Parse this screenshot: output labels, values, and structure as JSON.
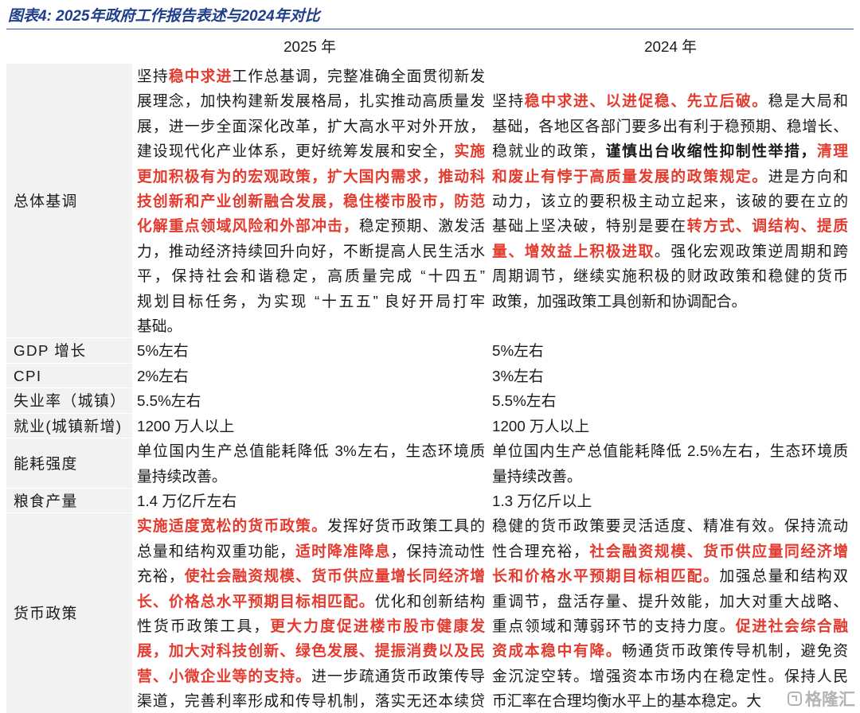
{
  "title": "图表4: 2025年政府工作报告表述与2024年对比",
  "header": {
    "col2025": "2025 年",
    "col2024": "2024 年"
  },
  "colors": {
    "title": "#1f3e8a",
    "rule": "#2f55a4",
    "emphasis": "#e53a2e",
    "label_bg": "#f2f2f2"
  },
  "rows": [
    {
      "label": "总体基调",
      "y2025": [
        [
          {
            "t": "坚持"
          },
          {
            "t": "稳中求进",
            "s": "red"
          },
          {
            "t": "工作总基调，完整准确全面贯彻新发"
          }
        ],
        [
          {
            "t": "展理念，加快构建新发展格局，扎实推动高质量发"
          }
        ],
        [
          {
            "t": "展，进一步全面深化改革，扩大高水平对外开放，"
          }
        ],
        [
          {
            "t": "建设现代化产业体系，更好统筹发展和安全，"
          },
          {
            "t": "实施",
            "s": "red"
          }
        ],
        [
          {
            "t": "更加积极有为的宏观政策，扩大国内需求，推动科",
            "s": "red"
          }
        ],
        [
          {
            "t": "技创新和产业创新融合发展，稳住楼市股市，防范",
            "s": "red"
          }
        ],
        [
          {
            "t": "化解重点领域风险和外部冲击，",
            "s": "red"
          },
          {
            "t": "稳定预期、激发活"
          }
        ],
        [
          {
            "t": "力，推动经济持续回升向好，不断提高人民生活水"
          }
        ],
        [
          {
            "t": "平，保持社会和谐稳定，高质量完成 “十四五”"
          }
        ],
        [
          {
            "t": "规划目标任务，为实现 “十五五” 良好开局打牢"
          }
        ],
        [
          {
            "t": "基础。"
          }
        ]
      ],
      "y2024": [
        [
          {
            "t": "坚持"
          },
          {
            "t": "稳中求进、以进促稳、先立后破。",
            "s": "red"
          },
          {
            "t": "稳是大局和"
          }
        ],
        [
          {
            "t": "基础，各地区各部门要多出有利于稳预期、稳增长、"
          }
        ],
        [
          {
            "t": "稳就业的政策，"
          },
          {
            "t": "谨慎出台收缩性抑制性举措，",
            "s": "bold"
          },
          {
            "t": "清理",
            "s": "red"
          }
        ],
        [
          {
            "t": "和废止有悖于高质量发展的政策规定。",
            "s": "red"
          },
          {
            "t": "进是方向和"
          }
        ],
        [
          {
            "t": "动力，该立的要积极主动立起来，该破的要在立的"
          }
        ],
        [
          {
            "t": "基础上坚决破，特别是要在"
          },
          {
            "t": "转方式、调结构、提质",
            "s": "red"
          }
        ],
        [
          {
            "t": "量、增效益上积极进取",
            "s": "red"
          },
          {
            "t": "。强化宏观政策逆周期和跨"
          }
        ],
        [
          {
            "t": "周期调节，继续实施积极的财政政策和稳健的货币"
          }
        ],
        [
          {
            "t": "政策，加强政策工具创新和协调配合。"
          }
        ]
      ]
    },
    {
      "label": "GDP 增长",
      "y2025": [
        [
          {
            "t": "5%左右"
          }
        ]
      ],
      "y2024": [
        [
          {
            "t": "5%左右"
          }
        ]
      ]
    },
    {
      "label": "CPI",
      "y2025": [
        [
          {
            "t": "2%左右"
          }
        ]
      ],
      "y2024": [
        [
          {
            "t": "3%左右"
          }
        ]
      ]
    },
    {
      "label": "失业率（城镇）",
      "y2025": [
        [
          {
            "t": "5.5%左右"
          }
        ]
      ],
      "y2024": [
        [
          {
            "t": "5.5%左右"
          }
        ]
      ]
    },
    {
      "label": "就业(城镇新增)",
      "y2025": [
        [
          {
            "t": "1200 万人以上"
          }
        ]
      ],
      "y2024": [
        [
          {
            "t": "1200 万人以上"
          }
        ]
      ]
    },
    {
      "label": "能耗强度",
      "y2025": [
        [
          {
            "t": "单位国内生产总值能耗降低 3%左右，生态环境质"
          }
        ],
        [
          {
            "t": "量持续改善。"
          }
        ]
      ],
      "y2024": [
        [
          {
            "t": "单位国内生产总值能耗降低 2.5%左右，生态环境质"
          }
        ],
        [
          {
            "t": "量持续改善。"
          }
        ]
      ]
    },
    {
      "label": "粮食产量",
      "y2025": [
        [
          {
            "t": "1.4 万亿斤左右"
          }
        ]
      ],
      "y2024": [
        [
          {
            "t": "1.3 万亿斤以上"
          }
        ]
      ]
    },
    {
      "label": "货币政策",
      "y2025": [
        [
          {
            "t": "实施适度宽松的货币政策。",
            "s": "red"
          },
          {
            "t": "发挥好货币政策工具的"
          }
        ],
        [
          {
            "t": "总量和结构双重功能，"
          },
          {
            "t": "适时降准降息",
            "s": "red"
          },
          {
            "t": "，保持流动性"
          }
        ],
        [
          {
            "t": "充裕，"
          },
          {
            "t": "使社会融资规模、货币供应量增长同经济增",
            "s": "red"
          }
        ],
        [
          {
            "t": "长、价格总水平预期目标相匹配。",
            "s": "red"
          },
          {
            "t": "优化和创新结构"
          }
        ],
        [
          {
            "t": "性货币政策工具，"
          },
          {
            "t": "更大力度促进楼市股市健康发",
            "s": "red"
          }
        ],
        [
          {
            "t": "展，加大对科技创新、绿色发展、提振消费以及民",
            "s": "red"
          }
        ],
        [
          {
            "t": "营、小微企业等的支持。",
            "s": "red"
          },
          {
            "t": "进一步疏通货币政策传导"
          }
        ],
        [
          {
            "t": "渠道，完善利率形成和传导机制，落实无还本续贷"
          }
        ]
      ],
      "y2024": [
        [
          {
            "t": "稳健的货币政策要灵活适度、精准有效。保持流动"
          }
        ],
        [
          {
            "t": "性合理充裕，"
          },
          {
            "t": "社会融资规模、货币供应量同经济增",
            "s": "red"
          }
        ],
        [
          {
            "t": "长和价格水平预期目标相匹配。",
            "s": "red"
          },
          {
            "t": "加强总量和结构双"
          }
        ],
        [
          {
            "t": "重调节，盘活存量、提升效能，加大对重大战略、"
          }
        ],
        [
          {
            "t": "重点领域和薄弱环节的支持力度。"
          },
          {
            "t": "促进社会综合融",
            "s": "red"
          }
        ],
        [
          {
            "t": "资成本稳中有降。",
            "s": "red"
          },
          {
            "t": "畅通货币政策传导机制，避免资"
          }
        ],
        [
          {
            "t": "金沉淀空转。增强资本市场内在稳定性。保持人民"
          }
        ],
        [
          {
            "t": "币汇率在合理均衡水平上的基本稳定。大"
          }
        ]
      ]
    }
  ],
  "watermark": "格隆汇"
}
